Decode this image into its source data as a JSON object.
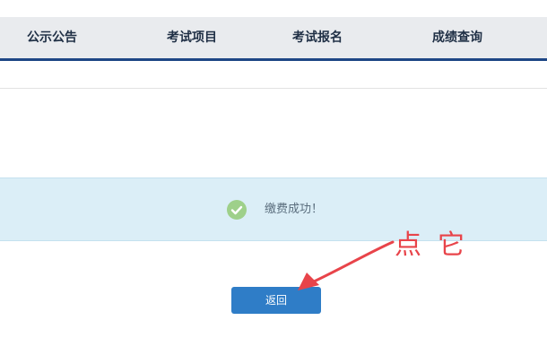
{
  "nav": {
    "items": [
      {
        "label": "公示公告"
      },
      {
        "label": "考试项目"
      },
      {
        "label": "考试报名"
      },
      {
        "label": "成绩查询"
      }
    ]
  },
  "message": {
    "text": "缴费成功！",
    "icon": "check-circle-icon"
  },
  "actions": {
    "back_label": "返回"
  },
  "annotation": {
    "text": "点它"
  },
  "colors": {
    "nav_underline": "#1d4685",
    "banner_bg": "#dbeef7",
    "check_green": "#9ed08a",
    "button_blue": "#2f7dc7",
    "annotation_red": "#e8444a"
  }
}
